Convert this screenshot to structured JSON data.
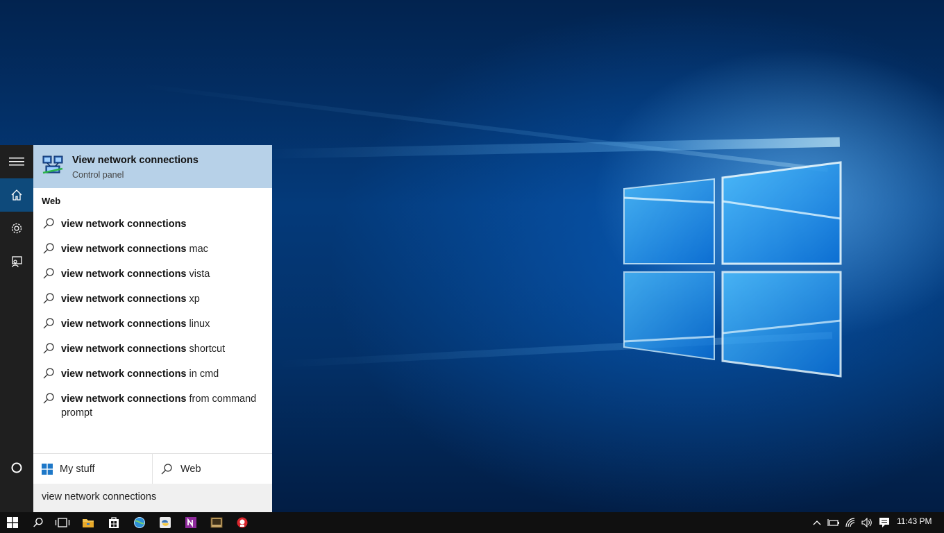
{
  "search": {
    "query": "view network connections",
    "best_match": {
      "title": "View network connections",
      "subtitle": "Control panel"
    },
    "web_heading": "Web",
    "suggestions": [
      {
        "bold": "view network connections",
        "rest": ""
      },
      {
        "bold": "view network connections",
        "rest": " mac"
      },
      {
        "bold": "view network connections",
        "rest": " vista"
      },
      {
        "bold": "view network connections",
        "rest": " xp"
      },
      {
        "bold": "view network connections",
        "rest": " linux"
      },
      {
        "bold": "view network connections",
        "rest": " shortcut"
      },
      {
        "bold": "view network connections",
        "rest": " in cmd"
      },
      {
        "bold": "view network connections",
        "rest": " from command prompt"
      }
    ],
    "scopes": {
      "my_stuff": "My stuff",
      "web": "Web"
    }
  },
  "rail": {
    "items": [
      {
        "icon": "hamburger-icon"
      },
      {
        "icon": "home-icon",
        "active": true
      },
      {
        "icon": "gear-icon"
      },
      {
        "icon": "feedback-icon"
      }
    ],
    "cortana_icon": "cortana-circle-icon"
  },
  "taskbar": {
    "pinned": [
      "start-icon",
      "search-icon",
      "task-view-icon",
      "file-explorer-icon",
      "store-icon",
      "network-globe-icon",
      "python-icon",
      "onenote-icon",
      "media-app-icon",
      "game-app-icon"
    ],
    "tray": [
      "chevron-up-icon",
      "battery-icon",
      "wifi-icon",
      "volume-icon",
      "action-center-icon"
    ],
    "clock": "11:43 PM"
  },
  "colors": {
    "accent": "#0e4a7b",
    "best_match_bg": "#b7d1e8",
    "rail_bg": "#1f1f1f",
    "taskbar_bg": "#101010",
    "search_box_bg": "#f0f0f0"
  }
}
